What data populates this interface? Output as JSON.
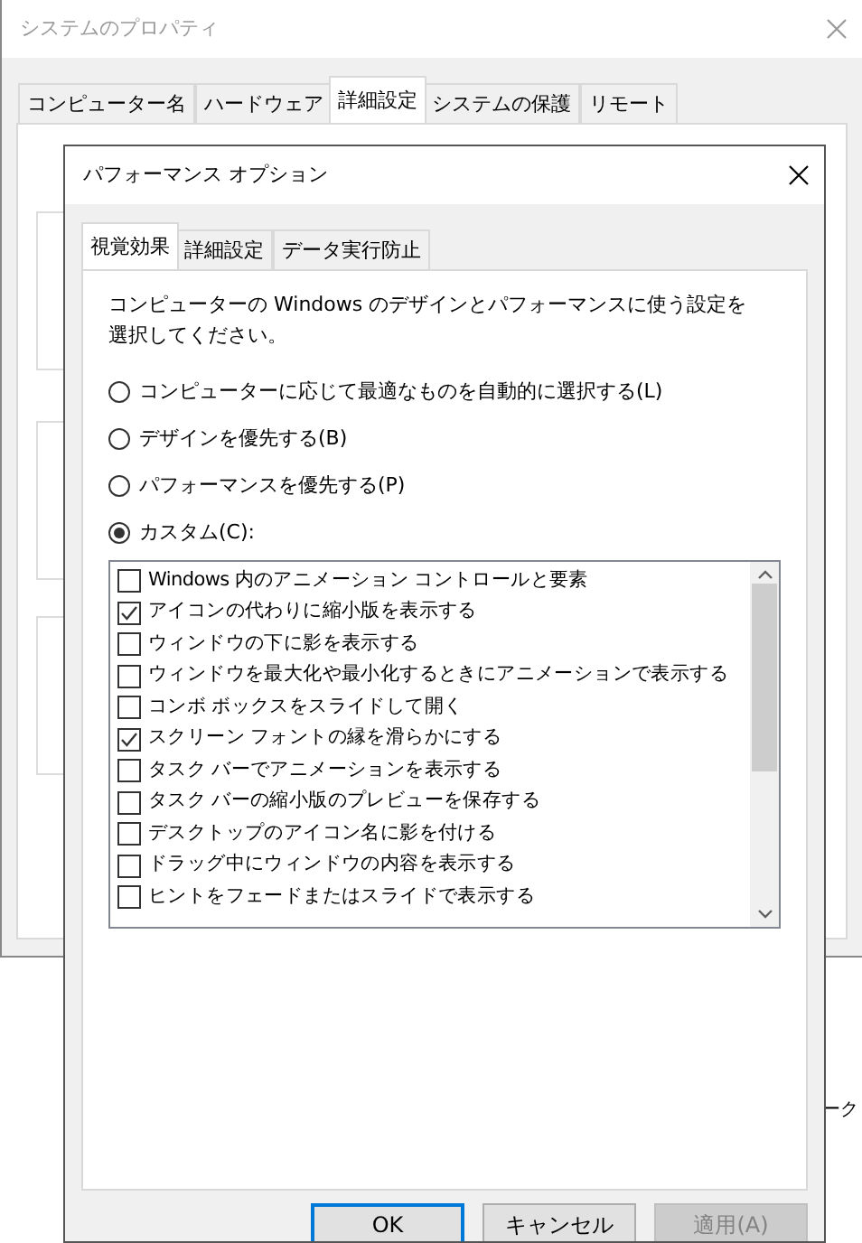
{
  "background_window": {
    "title": "システムのプロパティ",
    "tabs": [
      {
        "label": "コンピューター名",
        "selected": false
      },
      {
        "label": "ハードウェア",
        "selected": false
      },
      {
        "label": "詳細設定",
        "selected": true
      },
      {
        "label": "システムの保護",
        "selected": false
      },
      {
        "label": "リモート",
        "selected": false
      }
    ]
  },
  "performance_dialog": {
    "title": "パフォーマンス オプション",
    "tabs": [
      {
        "label": "視覚効果",
        "selected": true
      },
      {
        "label": "詳細設定",
        "selected": false
      },
      {
        "label": "データ実行防止",
        "selected": false
      }
    ],
    "description": "コンピューターの Windows のデザインとパフォーマンスに使う設定を選択してください。",
    "options": [
      {
        "label": "コンピューターに応じて最適なものを自動的に選択する(L)",
        "selected": false
      },
      {
        "label": "デザインを優先する(B)",
        "selected": false
      },
      {
        "label": "パフォーマンスを優先する(P)",
        "selected": false
      },
      {
        "label": "カスタム(C):",
        "selected": true
      }
    ],
    "effects": [
      {
        "label": "Windows 内のアニメーション コントロールと要素",
        "checked": false
      },
      {
        "label": "アイコンの代わりに縮小版を表示する",
        "checked": true
      },
      {
        "label": "ウィンドウの下に影を表示する",
        "checked": false
      },
      {
        "label": "ウィンドウを最大化や最小化するときにアニメーションで表示する",
        "checked": false
      },
      {
        "label": "コンボ ボックスをスライドして開く",
        "checked": false
      },
      {
        "label": "スクリーン フォントの縁を滑らかにする",
        "checked": true
      },
      {
        "label": "タスク バーでアニメーションを表示する",
        "checked": false
      },
      {
        "label": "タスク バーの縮小版のプレビューを保存する",
        "checked": false
      },
      {
        "label": "デスクトップのアイコン名に影を付ける",
        "checked": false
      },
      {
        "label": "ドラッグ中にウィンドウの内容を表示する",
        "checked": false
      },
      {
        "label": "ヒントをフェードまたはスライドで表示する",
        "checked": false
      }
    ],
    "buttons": [
      {
        "label": "OK",
        "default": true,
        "disabled": false
      },
      {
        "label": "キャンセル",
        "default": false,
        "disabled": false
      },
      {
        "label": "適用(A)",
        "default": false,
        "disabled": true
      }
    ]
  },
  "behind_window": {
    "text": "ーク"
  }
}
